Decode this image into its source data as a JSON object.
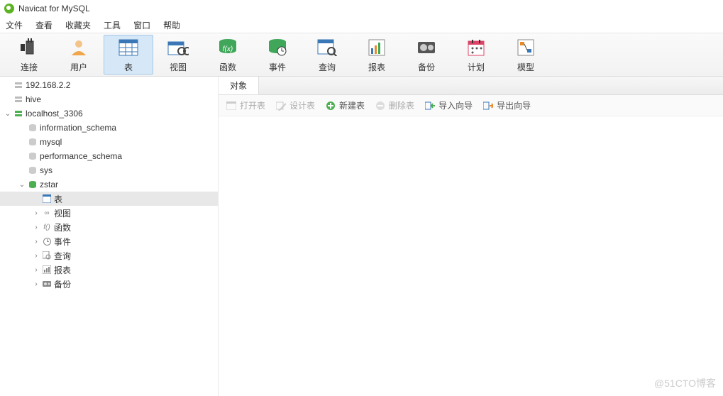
{
  "title": "Navicat for MySQL",
  "menu": {
    "file": "文件",
    "view": "查看",
    "fav": "收藏夹",
    "tools": "工具",
    "window": "窗口",
    "help": "帮助"
  },
  "toolbar": {
    "connect": "连接",
    "user": "用户",
    "table": "表",
    "view": "视图",
    "function": "函数",
    "event": "事件",
    "query": "查询",
    "report": "报表",
    "backup": "备份",
    "schedule": "计划",
    "model": "模型"
  },
  "tree": {
    "conn1": "192.168.2.2",
    "conn2": "hive",
    "conn3": "localhost_3306",
    "db1": "information_schema",
    "db2": "mysql",
    "db3": "performance_schema",
    "db4": "sys",
    "db5": "zstar",
    "obj_table": "表",
    "obj_view": "视图",
    "obj_func": "函数",
    "obj_event": "事件",
    "obj_query": "查询",
    "obj_report": "报表",
    "obj_backup": "备份"
  },
  "tab": {
    "object": "对象"
  },
  "objbar": {
    "open": "打开表",
    "design": "设计表",
    "new": "新建表",
    "delete": "删除表",
    "import": "导入向导",
    "export": "导出向导"
  },
  "watermark": "@51CTO博客"
}
